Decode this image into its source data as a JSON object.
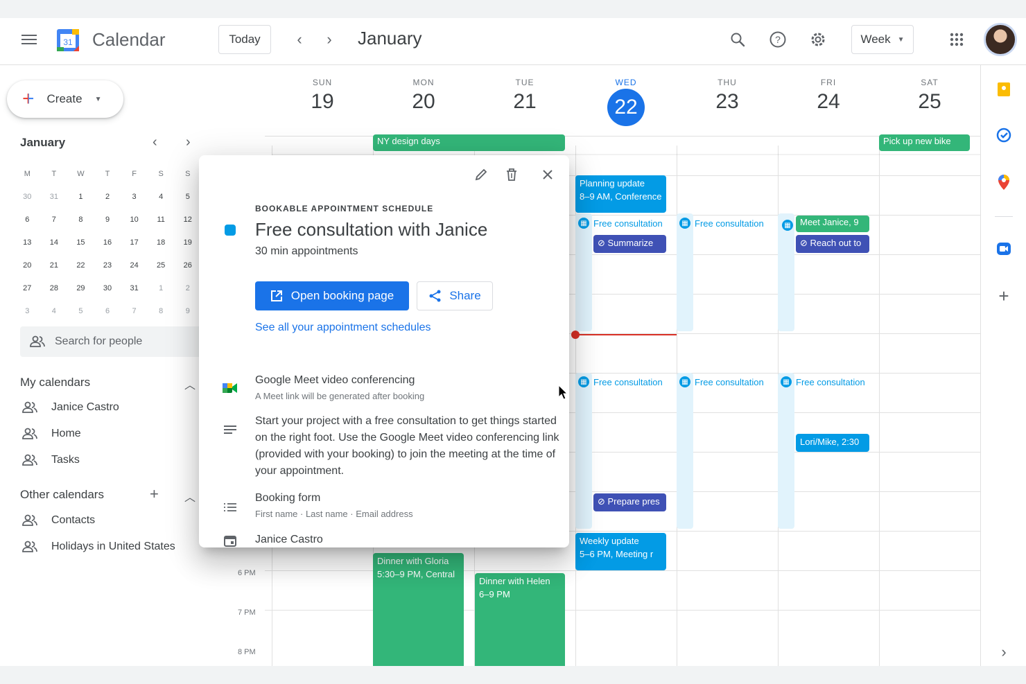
{
  "header": {
    "app_title": "Calendar",
    "logo_day": "31",
    "today_label": "Today",
    "month_title": "January",
    "view_label": "Week"
  },
  "sidebar": {
    "create_label": "Create",
    "mini_month": "January",
    "weekday_initials": [
      "M",
      "T",
      "W",
      "T",
      "F",
      "S",
      "S"
    ],
    "weeks": [
      [
        {
          "d": "30",
          "m": true
        },
        {
          "d": "31",
          "m": true
        },
        {
          "d": "1"
        },
        {
          "d": "2"
        },
        {
          "d": "3"
        },
        {
          "d": "4"
        },
        {
          "d": "5"
        }
      ],
      [
        {
          "d": "6"
        },
        {
          "d": "7"
        },
        {
          "d": "8"
        },
        {
          "d": "9"
        },
        {
          "d": "10"
        },
        {
          "d": "11"
        },
        {
          "d": "12"
        }
      ],
      [
        {
          "d": "13"
        },
        {
          "d": "14"
        },
        {
          "d": "15"
        },
        {
          "d": "16"
        },
        {
          "d": "17"
        },
        {
          "d": "18"
        },
        {
          "d": "19"
        }
      ],
      [
        {
          "d": "20"
        },
        {
          "d": "21"
        },
        {
          "d": "22"
        },
        {
          "d": "23"
        },
        {
          "d": "24"
        },
        {
          "d": "25"
        },
        {
          "d": "26"
        }
      ],
      [
        {
          "d": "27"
        },
        {
          "d": "28"
        },
        {
          "d": "29"
        },
        {
          "d": "30"
        },
        {
          "d": "31"
        },
        {
          "d": "1",
          "m": true
        },
        {
          "d": "2",
          "m": true
        }
      ],
      [
        {
          "d": "3",
          "m": true
        },
        {
          "d": "4",
          "m": true
        },
        {
          "d": "5",
          "m": true
        },
        {
          "d": "6",
          "m": true
        },
        {
          "d": "7",
          "m": true
        },
        {
          "d": "8",
          "m": true
        },
        {
          "d": "9",
          "m": true
        }
      ]
    ],
    "search_placeholder": "Search for people",
    "my_calendars_title": "My calendars",
    "my_calendars": [
      "Janice Castro",
      "Home",
      "Tasks"
    ],
    "other_calendars_title": "Other calendars",
    "other_calendars": [
      "Contacts",
      "Holidays in United States"
    ]
  },
  "days": [
    {
      "name": "SUN",
      "num": "19"
    },
    {
      "name": "MON",
      "num": "20"
    },
    {
      "name": "TUE",
      "num": "21"
    },
    {
      "name": "WED",
      "num": "22",
      "today": true
    },
    {
      "name": "THU",
      "num": "23"
    },
    {
      "name": "FRI",
      "num": "24"
    },
    {
      "name": "SAT",
      "num": "25"
    }
  ],
  "time_labels": [
    "6 PM",
    "7 PM",
    "8 PM"
  ],
  "events": {
    "ny_design_days": "NY design days",
    "pick_up_bike": "Pick up new bike",
    "planning_update_title": "Planning update",
    "planning_update_sub": "8–9 AM, Conference",
    "free_consult": "Free consultation",
    "summarize": "Summarize",
    "meet_janice": "Meet Janice, 9",
    "reach_out": "Reach out to",
    "lori_mike": "Lori/Mike, 2:30",
    "prepare": "Prepare pres",
    "weekly_update_title": "Weekly update",
    "weekly_update_sub": "5–6 PM, Meeting r",
    "dinner_gloria_title": "Dinner with Gloria",
    "dinner_gloria_sub": "5:30–9 PM, Central",
    "dinner_helen_title": "Dinner with Helen",
    "dinner_helen_sub": "6–9 PM"
  },
  "popup": {
    "kicker": "BOOKABLE APPOINTMENT SCHEDULE",
    "title": "Free consultation with Janice",
    "subtitle": "30 min appointments",
    "open_booking": "Open booking page",
    "share": "Share",
    "see_all": "See all your appointment schedules",
    "meet_title": "Google Meet video conferencing",
    "meet_sub": "A Meet link will be generated after booking",
    "description": "Start your project with a free consultation to get things started on the right foot. Use the Google Meet video conferencing link (provided with your booking) to join the meeting at the time of your appointment.",
    "form_title": "Booking form",
    "form_fields": "First name · Last name · Email address",
    "calendar_owner": "Janice Castro"
  },
  "colors": {
    "accent": "#1a73e8",
    "event_green": "#33b679",
    "event_blue": "#039be5",
    "event_indigo": "#3f51b5",
    "now_line": "#d93025"
  }
}
